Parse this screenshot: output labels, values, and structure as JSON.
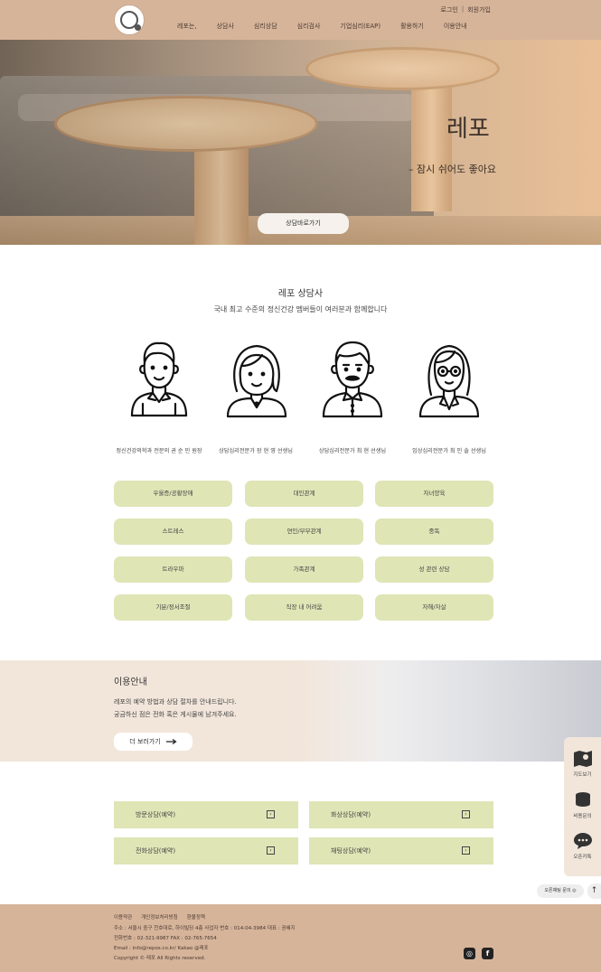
{
  "header": {
    "login": "로그인",
    "separator": "|",
    "signup": "회원가입",
    "nav": [
      "레포는,",
      "상담사",
      "심리상담",
      "심리검사",
      "기업심리(EAP)",
      "활용하기",
      "이용안내"
    ]
  },
  "hero": {
    "title": "레포",
    "subtitle": "– 잠시 쉬어도 좋아요",
    "button": "상담바로가기"
  },
  "counselors": {
    "title": "레포 상담사",
    "subtitle": "국내 최고 수준의 정신건강 멤버들이 여러분과 함께합니다",
    "people": [
      {
        "label": "정신건강의학과 전문의 권 순 민 원장",
        "icon": "male-doctor-icon"
      },
      {
        "label": "상담심리전문가 장 현 영 선생님",
        "icon": "female-counselor-icon"
      },
      {
        "label": "상담심리전문가 최 현 선생님",
        "icon": "male-counselor-icon"
      },
      {
        "label": "임상심리전문가 최 인 솔 선생님",
        "icon": "female-psychologist-icon"
      }
    ]
  },
  "tags": [
    "우울증/공황장애",
    "대인관계",
    "자녀양육",
    "스트레스",
    "연인/부부관계",
    "중독",
    "트라우마",
    "가족관계",
    "성 관련 상담",
    "기분/정서조절",
    "직장 내 어려움",
    "자해/자살"
  ],
  "info": {
    "title": "이용안내",
    "line1": "레포의 예약 방법과 상담 절차를 안내드립니다.",
    "line2": "궁금하신 점은 전화 혹은 게시물에 남겨주세요.",
    "button": "더 보러가기",
    "button_icon": "arrow-right-icon"
  },
  "booking": [
    {
      "label": "방문상담(예약)"
    },
    {
      "label": "화상상담(예약)"
    },
    {
      "label": "전화상담(예약)"
    },
    {
      "label": "채팅상담(예약)"
    }
  ],
  "side": {
    "map": "지도보기",
    "price": "비용문의",
    "kakao": "오픈카톡",
    "chat": "오픈채팅 문의",
    "top": "↑"
  },
  "footer": {
    "links": [
      "이용약관",
      "개인정보처리방침",
      "환불정책"
    ],
    "address": "주소 : 서울시 중구 천호대로, 하이빌딩 4층     사업자 번호 : 014-04-3984     대표 : 권혜지",
    "phone": "전화번호 : 02-321-9987     FAX : 02-765-7654",
    "email": "Email : info@repos.co.kr/     Kakao @레포",
    "copyright": "Copyright © 레포 All Rights reserved."
  },
  "colors": {
    "header_bg": "#d6b49a",
    "tag_bg": "#dfe5b5",
    "info_bg": "#f2e6db"
  }
}
